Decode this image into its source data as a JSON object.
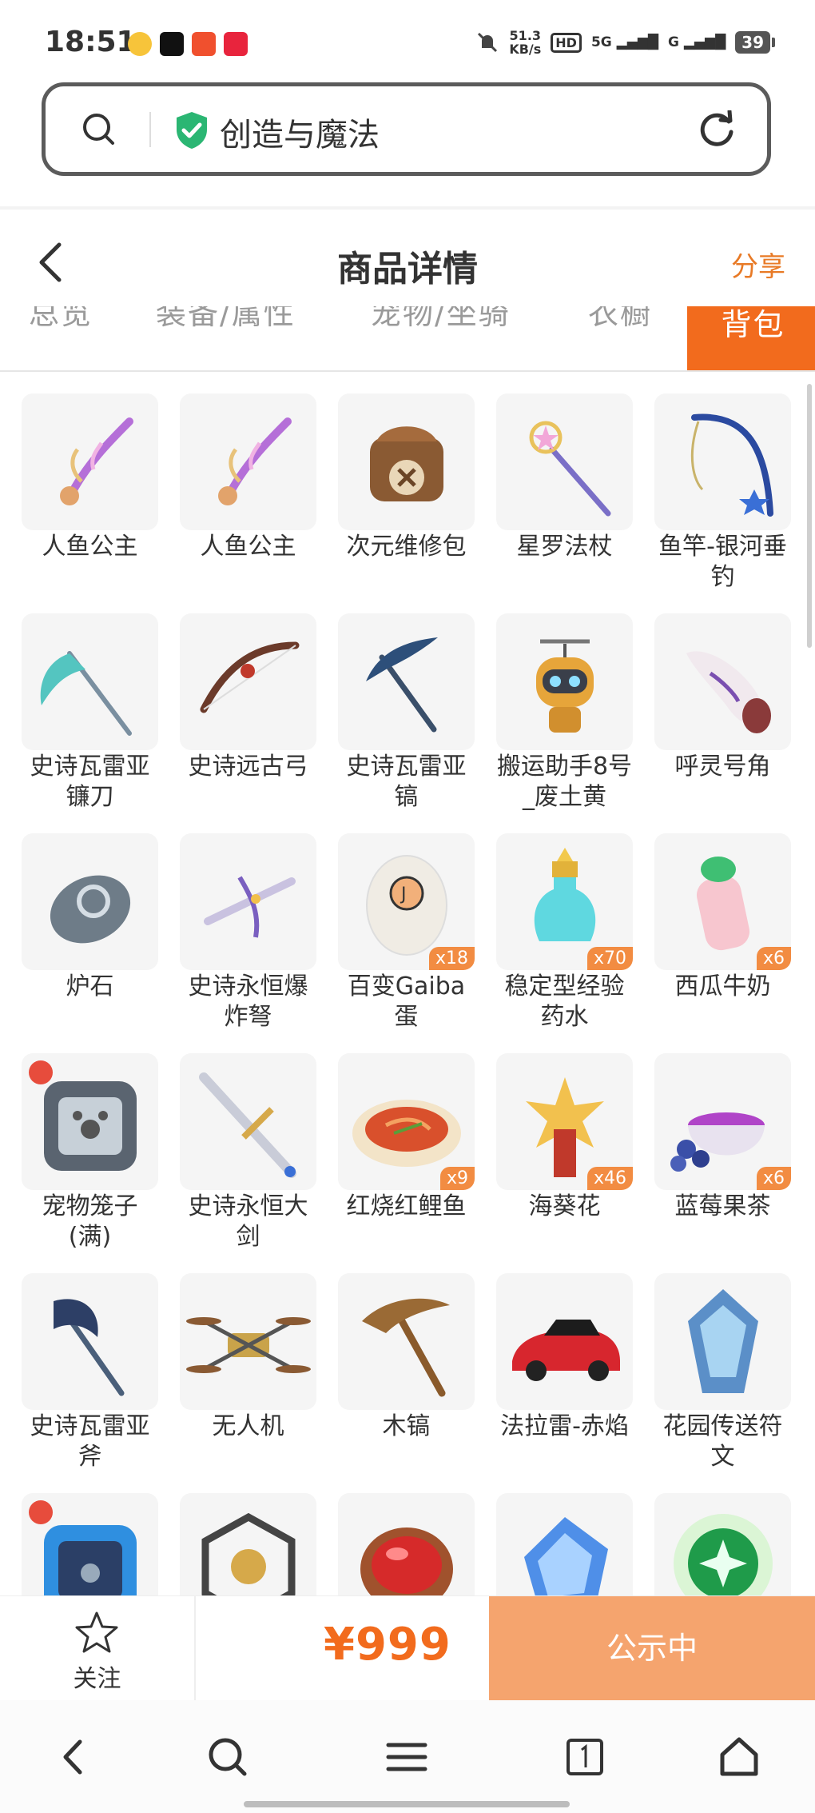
{
  "status_bar": {
    "time": "18:51",
    "net_speed_value": "51.3",
    "net_speed_unit": "KB/s",
    "hd_label": "HD",
    "signal_5g": "5G",
    "signal_g": "G",
    "battery": "39"
  },
  "search": {
    "text": "创造与魔法"
  },
  "header": {
    "title": "商品详情",
    "share": "分享"
  },
  "tabs": [
    {
      "label": "总览"
    },
    {
      "label": "装备/属性"
    },
    {
      "label": "宠物/坐骑"
    },
    {
      "label": "衣橱"
    },
    {
      "label": "背包"
    }
  ],
  "items": [
    {
      "name": "人鱼公主",
      "icon": "pink-staff-icon",
      "qty": ""
    },
    {
      "name": "人鱼公主",
      "icon": "pink-staff-icon",
      "qty": ""
    },
    {
      "name": "次元维修包",
      "icon": "repair-bag-icon",
      "qty": ""
    },
    {
      "name": "星罗法杖",
      "icon": "star-wand-icon",
      "qty": ""
    },
    {
      "name": "鱼竿-银河垂钓",
      "icon": "fishing-rod-icon",
      "qty": ""
    },
    {
      "name": "史诗瓦雷亚镰刀",
      "icon": "scythe-icon",
      "qty": ""
    },
    {
      "name": "史诗远古弓",
      "icon": "bow-icon",
      "qty": ""
    },
    {
      "name": "史诗瓦雷亚镐",
      "icon": "pickaxe-icon",
      "qty": ""
    },
    {
      "name": "搬运助手8号_废土黄",
      "icon": "robot-icon",
      "qty": ""
    },
    {
      "name": "呼灵号角",
      "icon": "horn-icon",
      "qty": ""
    },
    {
      "name": "炉石",
      "icon": "hearthstone-icon",
      "qty": ""
    },
    {
      "name": "史诗永恒爆炸弩",
      "icon": "crossbow-icon",
      "qty": ""
    },
    {
      "name": "百变Gaiba蛋",
      "icon": "egg-icon",
      "qty": "x18"
    },
    {
      "name": "稳定型经验药水",
      "icon": "potion-icon",
      "qty": "x70"
    },
    {
      "name": "西瓜牛奶",
      "icon": "milk-bottle-icon",
      "qty": "x6"
    },
    {
      "name": "宠物笼子(满)",
      "icon": "pet-cage-icon",
      "qty": ""
    },
    {
      "name": "史诗永恒大剑",
      "icon": "greatsword-icon",
      "qty": ""
    },
    {
      "name": "红烧红鲤鱼",
      "icon": "fish-dish-icon",
      "qty": "x9"
    },
    {
      "name": "海葵花",
      "icon": "anemone-flower-icon",
      "qty": "x46"
    },
    {
      "name": "蓝莓果茶",
      "icon": "blueberry-tea-icon",
      "qty": "x6"
    },
    {
      "name": "史诗瓦雷亚斧",
      "icon": "axe-icon",
      "qty": ""
    },
    {
      "name": "无人机",
      "icon": "drone-icon",
      "qty": ""
    },
    {
      "name": "木镐",
      "icon": "wooden-pickaxe-icon",
      "qty": ""
    },
    {
      "name": "法拉雷-赤焰",
      "icon": "red-car-icon",
      "qty": ""
    },
    {
      "name": "花园传送符文",
      "icon": "teleport-rune-icon",
      "qty": ""
    },
    {
      "name": "",
      "icon": "blue-pet-cage-icon",
      "qty": ""
    },
    {
      "name": "",
      "icon": "cube-frame-icon",
      "qty": ""
    },
    {
      "name": "",
      "icon": "red-gem-icon",
      "qty": ""
    },
    {
      "name": "",
      "icon": "blue-crystal-icon",
      "qty": ""
    },
    {
      "name": "",
      "icon": "green-orb-icon",
      "qty": ""
    }
  ],
  "action_bar": {
    "follow": "关注",
    "price": "¥999",
    "status": "公示中"
  },
  "colors": {
    "accent": "#f26b1d",
    "status_button": "#f5a46e",
    "qty_badge": "#f28c42"
  }
}
